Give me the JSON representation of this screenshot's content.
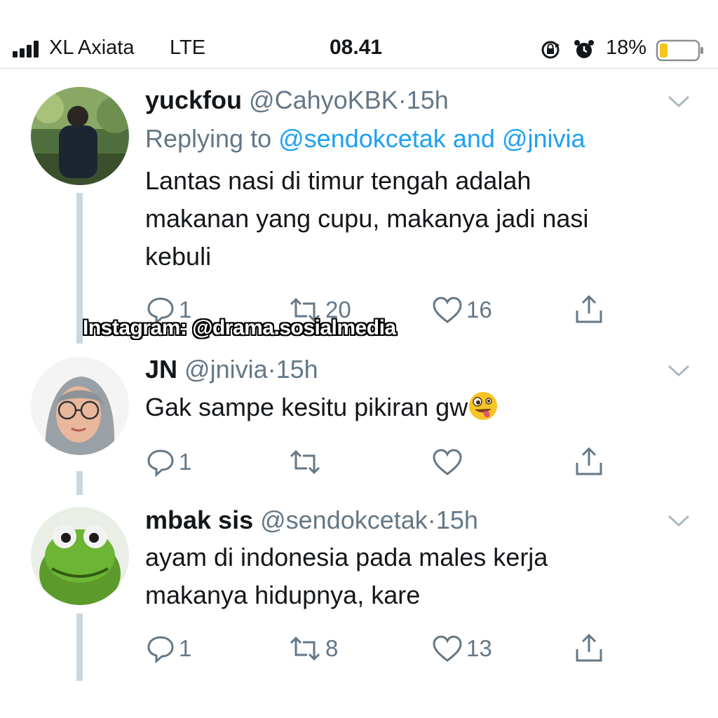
{
  "status_bar": {
    "carrier": "XL Axiata",
    "network": "LTE",
    "time": "08.41",
    "battery": "18%",
    "icons": [
      "signal-icon",
      "rotation-lock-icon",
      "alarm-icon",
      "battery-icon"
    ]
  },
  "watermark": "Instagram: @drama.sosialmedia",
  "colors": {
    "link": "#1da1f2",
    "muted": "#657786",
    "text": "#14171a",
    "thread": "#ccd6dd",
    "battery_low": "#f5c518"
  },
  "tweets": [
    {
      "name": "yuckfou",
      "handle": "@CahyoKBK",
      "dot": "·",
      "time": "15h",
      "reply_prefix": "Replying to",
      "reply_mention_1": "@sendokcetak",
      "reply_and": "and",
      "reply_mention_2": "@jnivia",
      "text_line_1": "Lantas nasi di timur tengah adalah",
      "text_line_2": "makanan yang cupu, makanya jadi nasi",
      "text_line_3": "kebuli",
      "replies": "1",
      "retweets": "20",
      "likes": "16"
    },
    {
      "name": "JN",
      "handle": "@jnivia",
      "dot": "·",
      "time": "15h",
      "text_line_1": "Gak sampe kesitu pikiran gw",
      "emoji": "zany-face-emoji",
      "replies": "1",
      "retweets": "",
      "likes": ""
    },
    {
      "name": "mbak sis",
      "handle": "@sendokcetak",
      "dot": "·",
      "time": "15h",
      "text_line_1": "ayam di indonesia pada males kerja",
      "text_line_2": "makanya hidupnya, kare",
      "replies": "1",
      "retweets": "8",
      "likes": "13"
    }
  ]
}
